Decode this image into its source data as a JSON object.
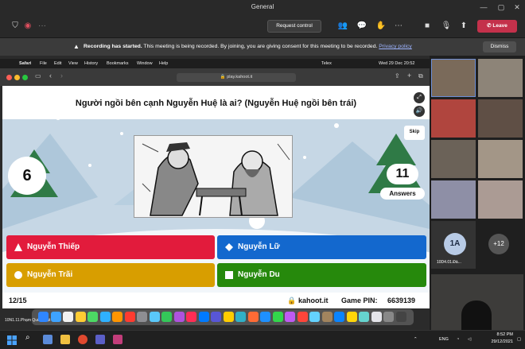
{
  "teams": {
    "window_title": "General",
    "request_control_label": "Request control",
    "leave_label": "Leave",
    "banner_title": "Recording has started.",
    "banner_text": "This meeting is being recorded. By joining, you are giving consent for this meeting to be recorded.",
    "privacy_link": "Privacy policy",
    "dismiss_label": "Dismiss"
  },
  "mac": {
    "menu": [
      "Safari",
      "File",
      "Edit",
      "View",
      "History",
      "Bookmarks",
      "Window",
      "Help"
    ],
    "status_app": "Telex",
    "clock": "Wed 29 Dec  20:52",
    "url": "play.kahoot.it"
  },
  "kahoot": {
    "question": "Người ngồi bên cạnh Nguyễn Huệ là ai? (Nguyễn Huệ ngồi bên trái)",
    "timer": "6",
    "answers_count": "11",
    "answers_label": "Answers",
    "skip_label": "Skip",
    "answers": [
      {
        "label": "Nguyễn Thiếp",
        "color": "#e21b3c",
        "shape": "triangle"
      },
      {
        "label": "Nguyễn Lữ",
        "color": "#1368ce",
        "shape": "diamond"
      },
      {
        "label": "Nguyễn Trãi",
        "color": "#d89e00",
        "shape": "circle"
      },
      {
        "label": "Nguyễn Du",
        "color": "#26890c",
        "shape": "square"
      }
    ],
    "progress": "12/15",
    "brand": "kahoot.it",
    "game_pin_label": "Game PIN:",
    "game_pin": "6639139"
  },
  "dock_label": "10N1.11.Phạm Quốc Luật",
  "participants": {
    "avatar_initials": "1A",
    "avatar_name": "10D4.01.Đà...",
    "more_count": "+12"
  },
  "taskbar": {
    "lang": "ENG",
    "time": "8:52 PM",
    "date": "29/12/2021"
  }
}
